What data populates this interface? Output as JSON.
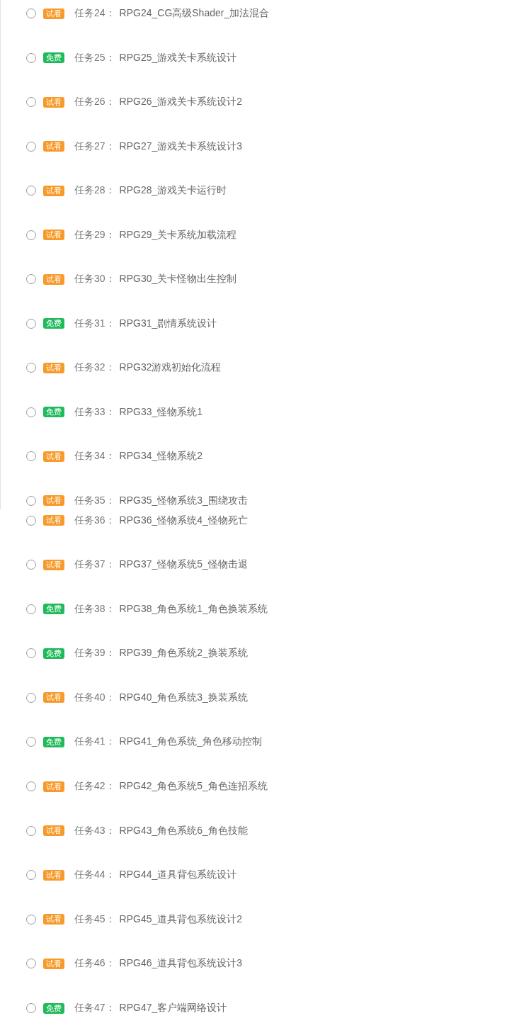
{
  "sections": [
    {
      "tasks": [
        {
          "kind": "trial",
          "badge": "试看",
          "label": "任务24：",
          "title": "RPG24_CG高级Shader_加法混合",
          "checked": false
        },
        {
          "kind": "free",
          "badge": "免费",
          "label": "任务25：",
          "title": "RPG25_游戏关卡系统设计",
          "checked": false
        },
        {
          "kind": "trial",
          "badge": "试看",
          "label": "任务26：",
          "title": "RPG26_游戏关卡系统设计2",
          "checked": false
        },
        {
          "kind": "trial",
          "badge": "试看",
          "label": "任务27：",
          "title": "RPG27_游戏关卡系统设计3",
          "checked": false
        },
        {
          "kind": "trial",
          "badge": "试看",
          "label": "任务28：",
          "title": "RPG28_游戏关卡运行时",
          "checked": false
        },
        {
          "kind": "trial",
          "badge": "试看",
          "label": "任务29：",
          "title": "RPG29_关卡系统加载流程",
          "checked": false
        },
        {
          "kind": "trial",
          "badge": "试看",
          "label": "任务30：",
          "title": "RPG30_关卡怪物出生控制",
          "checked": false
        },
        {
          "kind": "free",
          "badge": "免费",
          "label": "任务31：",
          "title": "RPG31_剧情系统设计",
          "checked": false
        },
        {
          "kind": "trial",
          "badge": "试看",
          "label": "任务32：",
          "title": "RPG32游戏初始化流程",
          "checked": false
        },
        {
          "kind": "free",
          "badge": "免费",
          "label": "任务33：",
          "title": "RPG33_怪物系统1",
          "checked": false
        },
        {
          "kind": "trial",
          "badge": "试看",
          "label": "任务34：",
          "title": "RPG34_怪物系统2",
          "checked": false
        },
        {
          "kind": "trial",
          "badge": "试看",
          "label": "任务35：",
          "title": "RPG35_怪物系统3_围绕攻击",
          "checked": false
        }
      ]
    },
    {
      "tasks": [
        {
          "kind": "trial",
          "badge": "试看",
          "label": "任务36：",
          "title": "RPG36_怪物系统4_怪物死亡",
          "checked": false
        },
        {
          "kind": "trial",
          "badge": "试看",
          "label": "任务37：",
          "title": "RPG37_怪物系统5_怪物击退",
          "checked": false
        },
        {
          "kind": "free",
          "badge": "免费",
          "label": "任务38：",
          "title": "RPG38_角色系统1_角色换装系统",
          "checked": false
        },
        {
          "kind": "free",
          "badge": "免费",
          "label": "任务39：",
          "title": "RPG39_角色系统2_换装系统",
          "checked": false
        },
        {
          "kind": "trial",
          "badge": "试看",
          "label": "任务40：",
          "title": "RPG40_角色系统3_换装系统",
          "checked": false
        },
        {
          "kind": "free",
          "badge": "免费",
          "label": "任务41：",
          "title": "RPG41_角色系统_角色移动控制",
          "checked": false
        },
        {
          "kind": "trial",
          "badge": "试看",
          "label": "任务42：",
          "title": "RPG42_角色系统5_角色连招系统",
          "checked": false
        },
        {
          "kind": "trial",
          "badge": "试看",
          "label": "任务43：",
          "title": "RPG43_角色系统6_角色技能",
          "checked": false
        },
        {
          "kind": "trial",
          "badge": "试看",
          "label": "任务44：",
          "title": "RPG44_道具背包系统设计",
          "checked": false
        },
        {
          "kind": "trial",
          "badge": "试看",
          "label": "任务45：",
          "title": "RPG45_道具背包系统设计2",
          "checked": false
        },
        {
          "kind": "trial",
          "badge": "试看",
          "label": "任务46：",
          "title": "RPG46_道具背包系统设计3",
          "checked": false
        },
        {
          "kind": "free",
          "badge": "免费",
          "label": "任务47：",
          "title": "RPG47_客户端网络设计",
          "checked": false
        }
      ]
    }
  ]
}
